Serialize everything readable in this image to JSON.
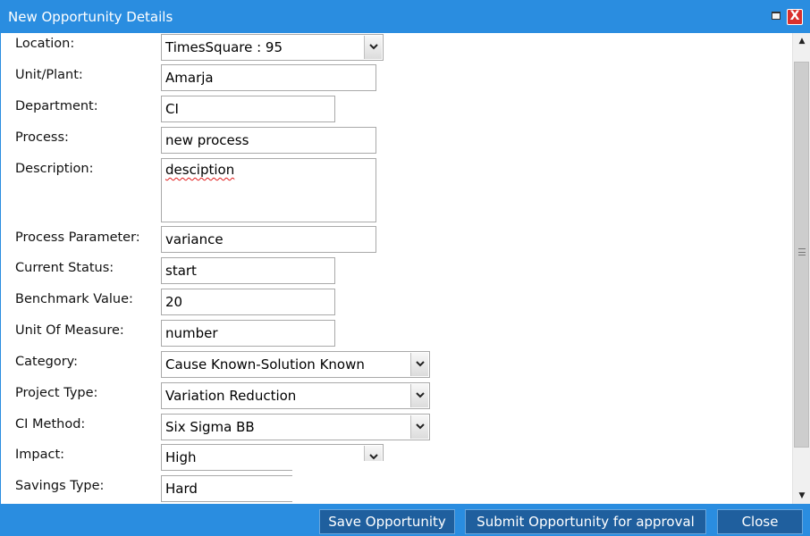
{
  "window": {
    "title": "New Opportunity Details",
    "close_glyph": "X"
  },
  "form": {
    "location": {
      "label": "Location:",
      "value": "TimesSquare : 95"
    },
    "unit_plant": {
      "label": "Unit/Plant:",
      "value": "Amarja"
    },
    "department": {
      "label": "Department:",
      "value": "CI"
    },
    "process": {
      "label": "Process:",
      "value": "new process"
    },
    "description": {
      "label": "Description:",
      "value": "desciption"
    },
    "process_parameter": {
      "label": "Process Parameter:",
      "value": "variance"
    },
    "current_status": {
      "label": "Current Status:",
      "value": "start"
    },
    "benchmark_value": {
      "label": "Benchmark Value:",
      "value": "20"
    },
    "unit_of_measure": {
      "label": "Unit Of Measure:",
      "value": "number"
    },
    "category": {
      "label": "Category:",
      "value": "Cause Known-Solution Known"
    },
    "project_type": {
      "label": "Project Type:",
      "value": "Variation Reduction"
    },
    "ci_method": {
      "label": "CI Method:",
      "value": "Six Sigma BB"
    },
    "impact": {
      "label": "Impact:",
      "value": "High"
    },
    "savings_type": {
      "label": "Savings Type:",
      "value": "Hard"
    }
  },
  "buttons": {
    "save": "Save Opportunity",
    "submit": "Submit Opportunity for approval",
    "close": "Close"
  },
  "colors": {
    "titlebar": "#2a8de0",
    "button": "#1f5f9e",
    "close_button": "#d9302c"
  },
  "icons": {
    "minimize": "minimize-icon",
    "close": "close-icon",
    "dropdown": "chevron-down-icon",
    "scroll_up": "arrow-up-icon",
    "scroll_down": "arrow-down-icon"
  }
}
